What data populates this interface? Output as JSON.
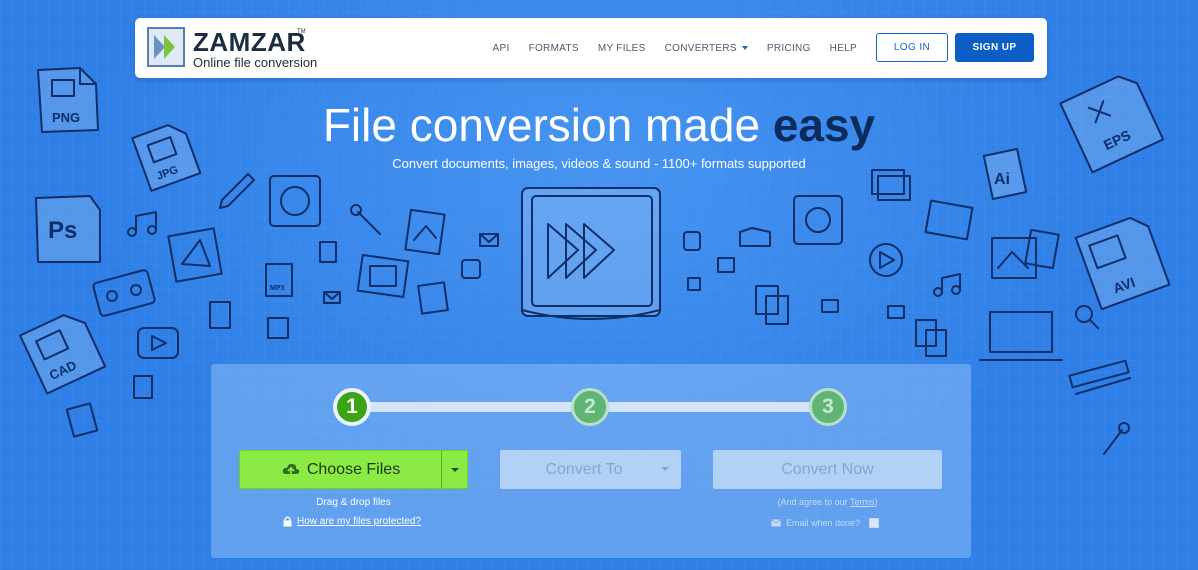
{
  "brand": {
    "name": "ZAMZAR",
    "trademark": "TM",
    "tagline": "Online file conversion"
  },
  "nav": {
    "items": [
      {
        "label": "API"
      },
      {
        "label": "FORMATS"
      },
      {
        "label": "MY FILES"
      },
      {
        "label": "CONVERTERS",
        "has_dropdown": true
      },
      {
        "label": "PRICING"
      },
      {
        "label": "HELP"
      }
    ],
    "login_label": "LOG IN",
    "signup_label": "SIGN UP"
  },
  "hero": {
    "title_plain": "File conversion made ",
    "title_emphasis": "easy",
    "subtitle": "Convert documents, images, videos & sound - 1100+ formats supported"
  },
  "converter": {
    "steps": [
      "1",
      "2",
      "3"
    ],
    "active_step": 1,
    "choose_files_label": "Choose Files",
    "drag_drop_text": "Drag & drop files",
    "protected_link": "How are my files protected?",
    "convert_to_label": "Convert To",
    "convert_now_label": "Convert Now",
    "agree_prefix": "(And agree to our ",
    "terms_label": "Terms",
    "agree_suffix": ")",
    "email_label": "Email when done?"
  },
  "doodle_labels": {
    "png": "PNG",
    "jpg": "JPG",
    "ps": "Ps",
    "cad": "CAD",
    "eps": "EPS",
    "ai": "Ai",
    "avi": "AVI",
    "mp3": "MP3"
  },
  "colors": {
    "background": "#2f7fe6",
    "accent": "#0d5ec4",
    "choose_button": "#8bea43",
    "step_active": "#3aa414",
    "title_emphasis": "#0c2a5c"
  }
}
